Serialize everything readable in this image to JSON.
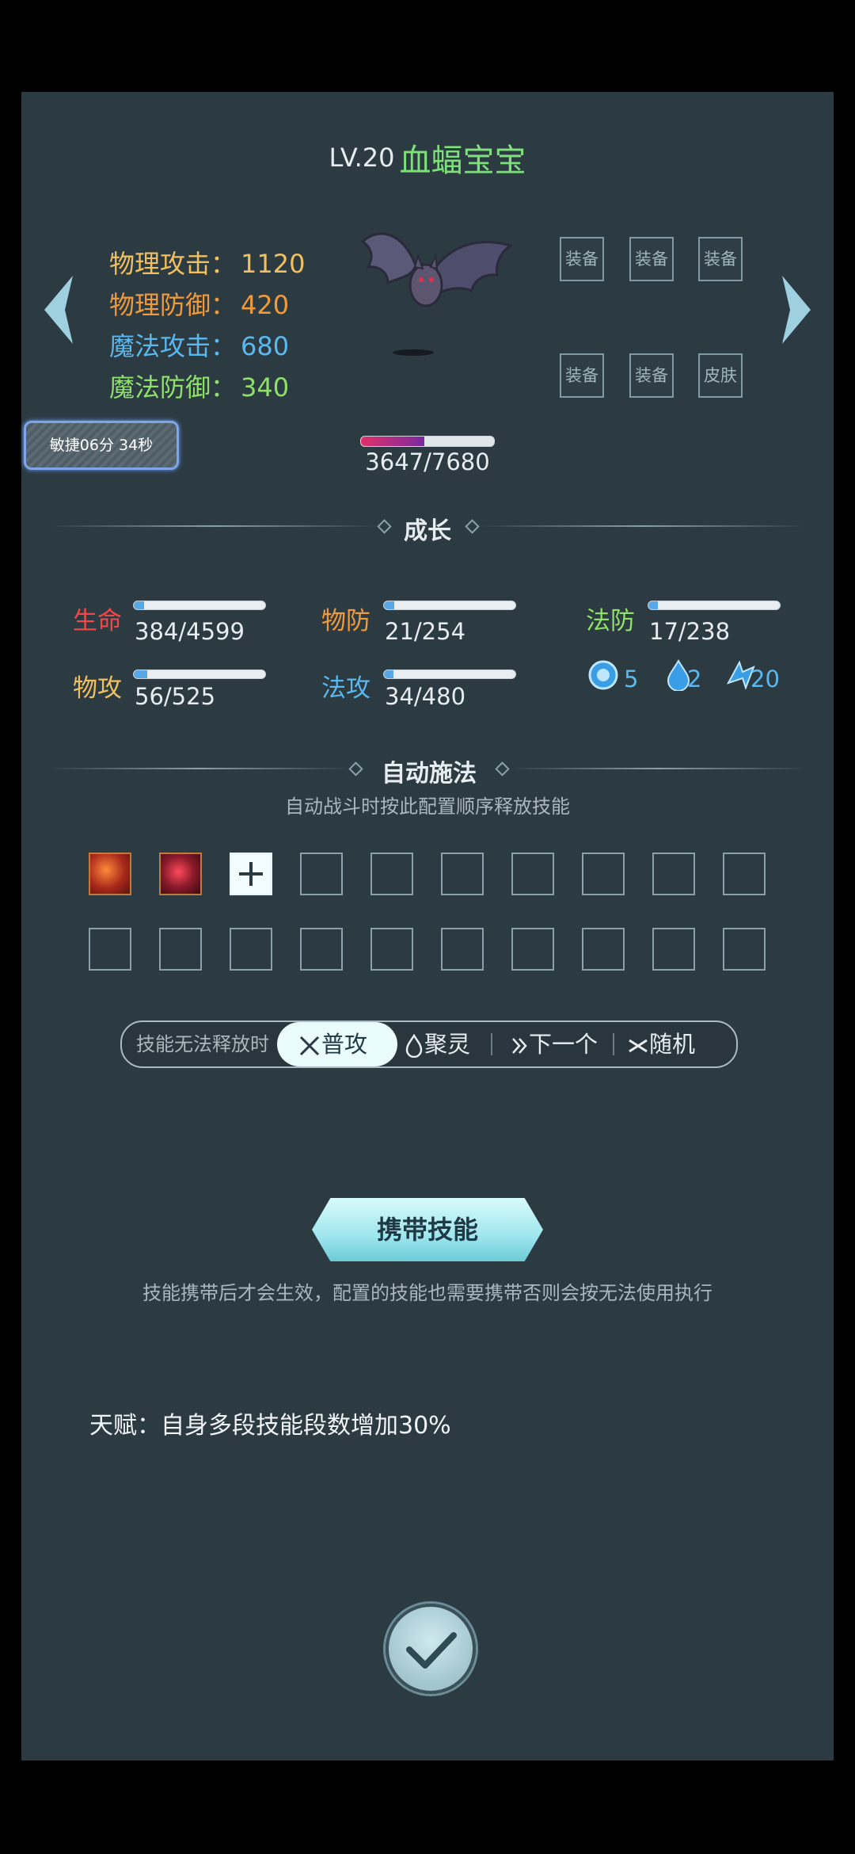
{
  "header": {
    "level": "LV.20",
    "pet_name": "血蝠宝宝"
  },
  "stats": [
    {
      "label": "物理攻击：",
      "value": "1120",
      "color": "#f0c060"
    },
    {
      "label": "物理防御：",
      "value": "420",
      "color": "#f09a3c"
    },
    {
      "label": "魔法攻击：",
      "value": "680",
      "color": "#5ab8ee"
    },
    {
      "label": "魔法防御：",
      "value": "340",
      "color": "#8ee06a"
    }
  ],
  "equip_slots": [
    "装备",
    "装备",
    "装备",
    "装备",
    "装备",
    "皮肤"
  ],
  "badge": "敏捷06分 34秒",
  "hp": {
    "text": "3647/7680",
    "fraction": 0.475
  },
  "growth": {
    "title": "成长",
    "items": [
      {
        "label": "生命",
        "value": "384/4599",
        "fraction": 0.08,
        "color": "#f04848"
      },
      {
        "label": "物防",
        "value": "21/254",
        "fraction": 0.08,
        "color": "#f09a3c"
      },
      {
        "label": "法防",
        "value": "17/238",
        "fraction": 0.07,
        "color": "#8ee06a"
      },
      {
        "label": "物攻",
        "value": "56/525",
        "fraction": 0.1,
        "color": "#f0c060"
      },
      {
        "label": "法攻",
        "value": "34/480",
        "fraction": 0.07,
        "color": "#5ab8ee"
      }
    ],
    "resources": [
      "5",
      "2",
      "20"
    ]
  },
  "auto_cast": {
    "title": "自动施法",
    "subtitle": "自动战斗时按此配置顺序释放技能"
  },
  "fallback": {
    "label": "技能无法释放时",
    "options": [
      "普攻",
      "聚灵",
      "下一个",
      "随机"
    ],
    "selected": "普攻"
  },
  "carry_button": "携带技能",
  "carry_hint": "技能携带后才会生效，配置的技能也需要携带否则会按无法使用执行",
  "talent": "天赋：自身多段技能段数增加30%"
}
